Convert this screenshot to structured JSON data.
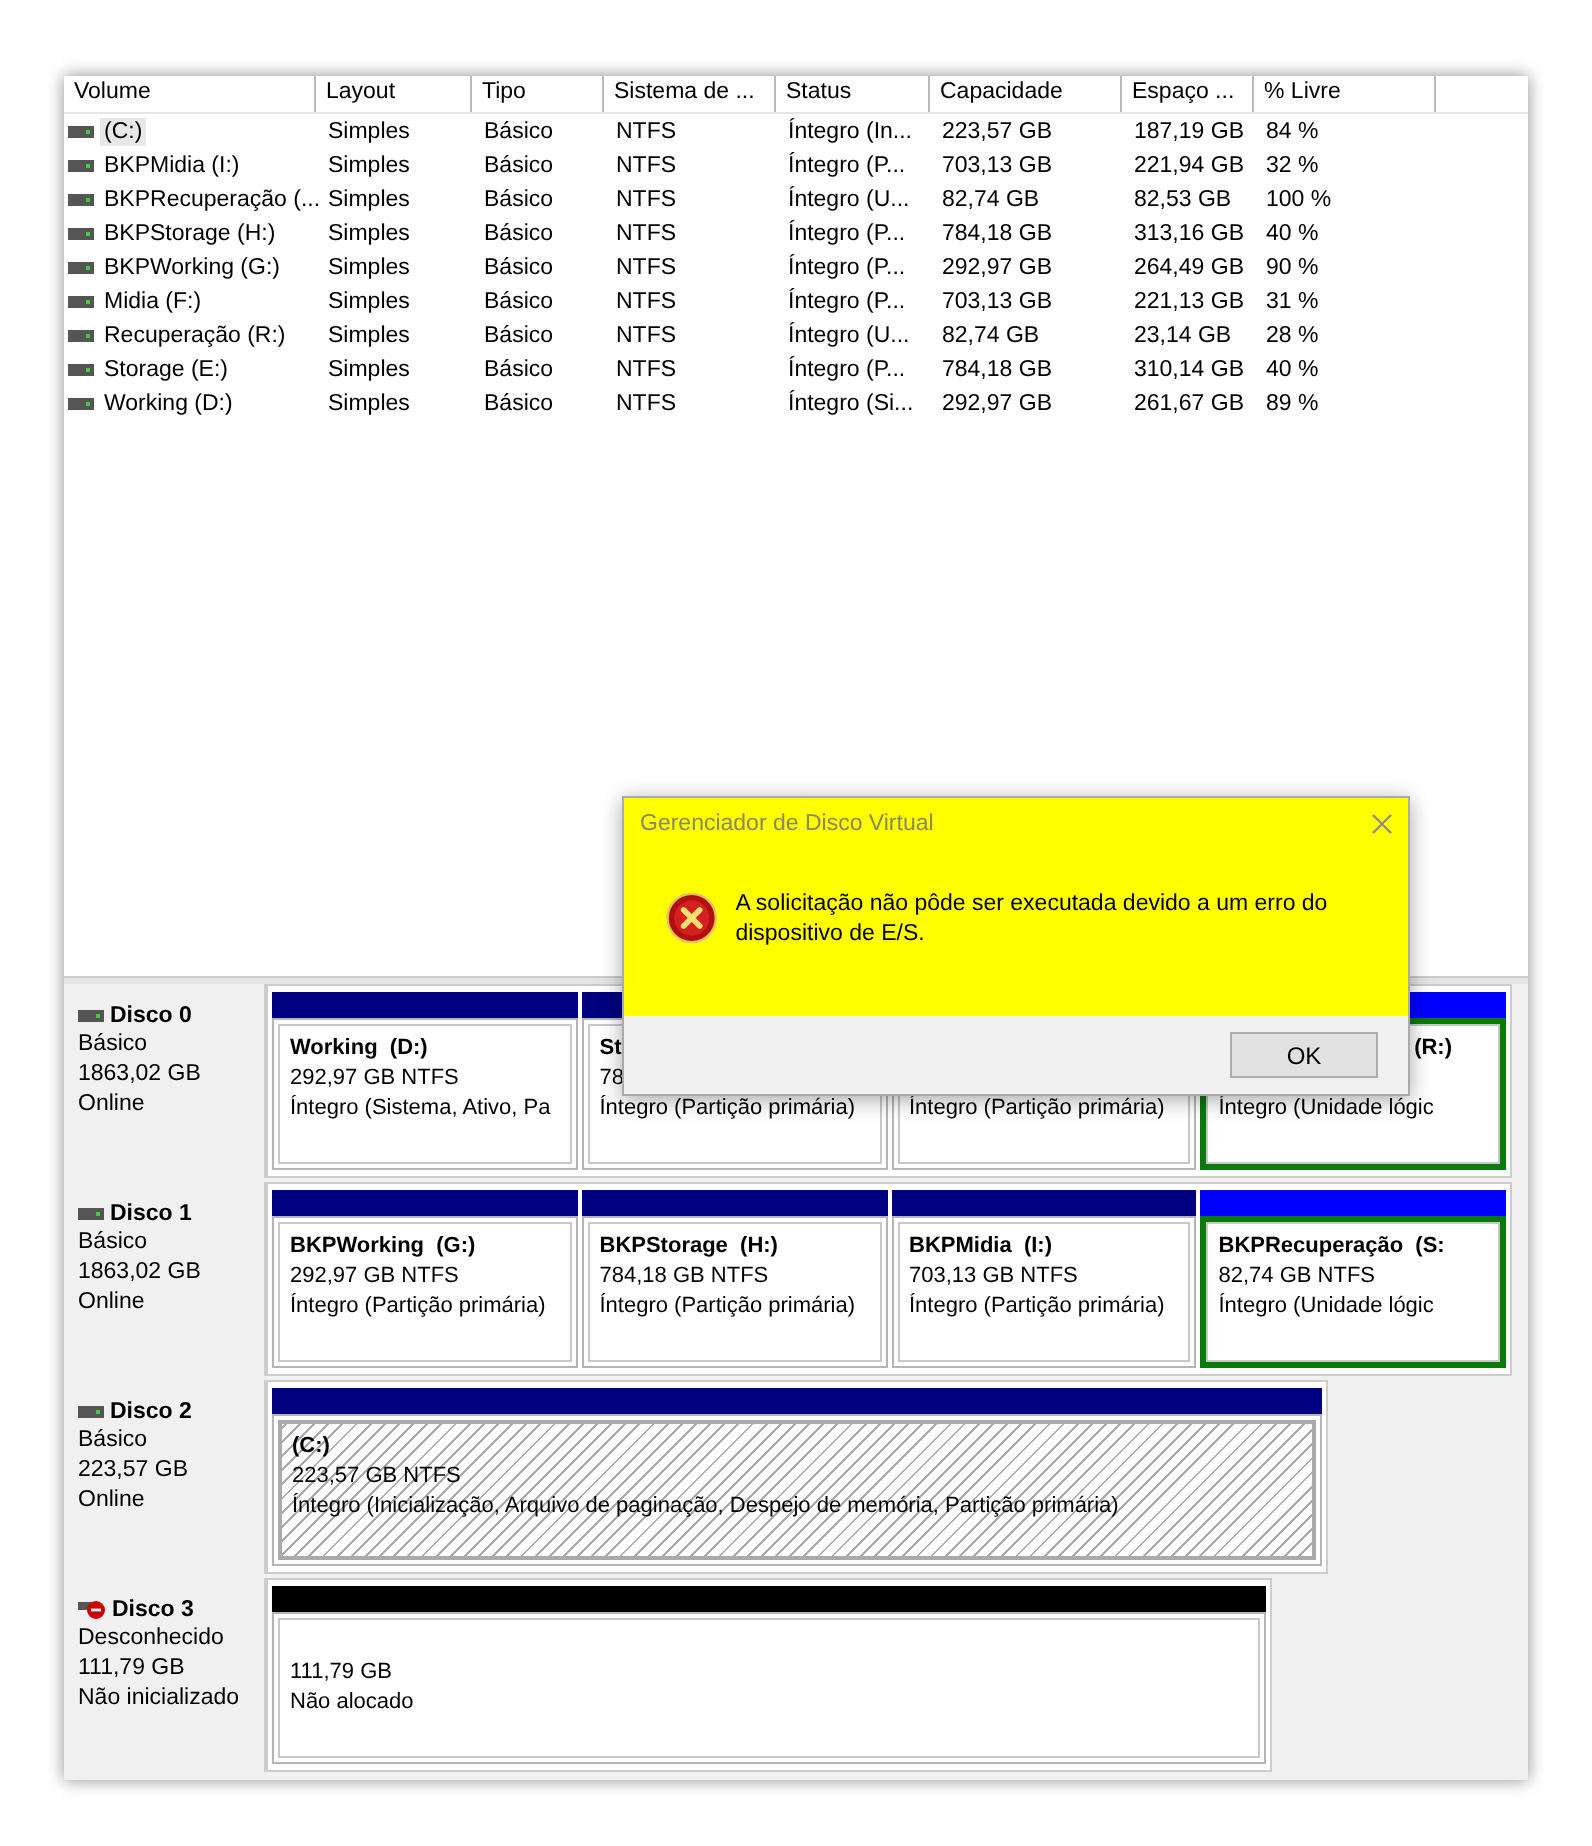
{
  "table": {
    "columns": [
      "Volume",
      "Layout",
      "Tipo",
      "Sistema de ...",
      "Status",
      "Capacidade",
      "Espaço ...",
      "% Livre"
    ],
    "rows": [
      {
        "cells": [
          "(C:)",
          "Simples",
          "Básico",
          "NTFS",
          "Íntegro (In...",
          "223,57 GB",
          "187,19 GB",
          "84 %"
        ],
        "selected": true
      },
      {
        "cells": [
          "BKPMidia (I:)",
          "Simples",
          "Básico",
          "NTFS",
          "Íntegro (P...",
          "703,13 GB",
          "221,94 GB",
          "32 %"
        ],
        "selected": false
      },
      {
        "cells": [
          "BKPRecuperação (...",
          "Simples",
          "Básico",
          "NTFS",
          "Íntegro (U...",
          "82,74 GB",
          "82,53 GB",
          "100 %"
        ],
        "selected": false
      },
      {
        "cells": [
          "BKPStorage (H:)",
          "Simples",
          "Básico",
          "NTFS",
          "Íntegro (P...",
          "784,18 GB",
          "313,16 GB",
          "40 %"
        ],
        "selected": false
      },
      {
        "cells": [
          "BKPWorking (G:)",
          "Simples",
          "Básico",
          "NTFS",
          "Íntegro (P...",
          "292,97 GB",
          "264,49 GB",
          "90 %"
        ],
        "selected": false
      },
      {
        "cells": [
          "Midia (F:)",
          "Simples",
          "Básico",
          "NTFS",
          "Íntegro (P...",
          "703,13 GB",
          "221,13 GB",
          "31 %"
        ],
        "selected": false
      },
      {
        "cells": [
          "Recuperação (R:)",
          "Simples",
          "Básico",
          "NTFS",
          "Íntegro (U...",
          "82,74 GB",
          "23,14 GB",
          "28 %"
        ],
        "selected": false
      },
      {
        "cells": [
          "Storage (E:)",
          "Simples",
          "Básico",
          "NTFS",
          "Íntegro (P...",
          "784,18 GB",
          "310,14 GB",
          "40 %"
        ],
        "selected": false
      },
      {
        "cells": [
          "Working (D:)",
          "Simples",
          "Básico",
          "NTFS",
          "Íntegro (Si...",
          "292,97 GB",
          "261,67 GB",
          "89 %"
        ],
        "selected": false
      }
    ]
  },
  "disks": [
    {
      "name": "Disco 0",
      "type": "Básico",
      "size": "1863,02 GB",
      "state": "Online",
      "kind": "ok",
      "partitions": [
        {
          "kind": "primary",
          "name": "Working  (D:)",
          "size": "292,97 GB NTFS",
          "status": "Íntegro (Sistema, Ativo, Pa",
          "selected": false
        },
        {
          "kind": "primary",
          "name": "St",
          "size": "78",
          "status": "Íntegro (Partição primária)",
          "selected": false
        },
        {
          "kind": "primary",
          "status": "Íntegro (Partição primária)",
          "selected": false
        },
        {
          "kind": "logical",
          "name": "(R:)",
          "status": "Íntegro (Unidade lógic",
          "selected": true,
          "covered": true
        }
      ]
    },
    {
      "name": "Disco 1",
      "type": "Básico",
      "size": "1863,02 GB",
      "state": "Online",
      "kind": "ok",
      "partitions": [
        {
          "kind": "primary",
          "name": "BKPWorking  (G:)",
          "size": "292,97 GB NTFS",
          "status": "Íntegro (Partição primária)",
          "selected": false
        },
        {
          "kind": "primary",
          "name": "BKPStorage  (H:)",
          "size": "784,18 GB NTFS",
          "status": "Íntegro (Partição primária)",
          "selected": false
        },
        {
          "kind": "primary",
          "name": "BKPMidia  (I:)",
          "size": "703,13 GB NTFS",
          "status": "Íntegro (Partição primária)",
          "selected": false
        },
        {
          "kind": "logical",
          "name": "BKPRecuperação  (S:",
          "size": "82,74 GB NTFS",
          "status": "Íntegro (Unidade lógic",
          "selected": true
        }
      ]
    },
    {
      "name": "Disco 2",
      "type": "Básico",
      "size": "223,57 GB",
      "state": "Online",
      "kind": "ok",
      "partitions": [
        {
          "kind": "system",
          "name": "(C:)",
          "size": "223,57 GB NTFS",
          "status": "Íntegro (Inicialização, Arquivo de paginação, Despejo de memória, Partição primária)",
          "selected": false
        }
      ]
    },
    {
      "name": "Disco 3",
      "type": "Desconhecido",
      "size": "111,79 GB",
      "state": "Não inicializado",
      "kind": "error",
      "partitions": [
        {
          "kind": "unallocated",
          "size": "111,79 GB",
          "status": "Não alocado",
          "selected": false
        }
      ]
    }
  ],
  "dialog": {
    "title": "Gerenciador de Disco Virtual",
    "message": "A solicitação não pôde ser executada devido a um erro do dispositivo de E/S.",
    "button": "OK"
  }
}
